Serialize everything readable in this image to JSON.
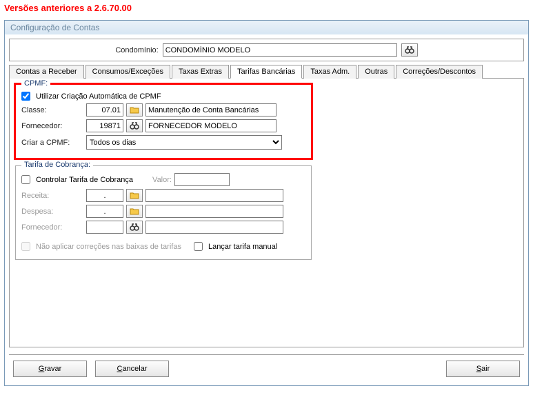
{
  "version_header": "Versões anteriores a 2.6.70.00",
  "window_title": "Configuração de Contas",
  "condominio": {
    "label": "Condomínio:",
    "value": "CONDOMÍNIO MODELO"
  },
  "tabs": {
    "receber": "Contas a Receber",
    "consumos": "Consumos/Exceções",
    "taxas": "Taxas Extras",
    "tarifas": "Tarifas Bancárias",
    "adm": "Taxas Adm.",
    "outras": "Outras",
    "correcoes": "Correções/Descontos"
  },
  "cpmf": {
    "legend": "CPMF:",
    "check_label": "Utilizar Criação Automática de CPMF",
    "classe_label": "Classe:",
    "classe_code": "07.01",
    "classe_desc": "Manutenção de Conta Bancárias",
    "fornecedor_label": "Fornecedor:",
    "fornecedor_code": "19871",
    "fornecedor_desc": "FORNECEDOR MODELO",
    "criar_label": "Criar a CPMF:",
    "criar_value": "Todos os dias"
  },
  "tarifa": {
    "legend": "Tarifa de Cobrança:",
    "controlar_label": "Controlar Tarifa de Cobrança",
    "valor_label": "Valor:",
    "receita_label": "Receita:",
    "receita_code": ".",
    "despesa_label": "Despesa:",
    "despesa_code": ".",
    "fornecedor_label": "Fornecedor:",
    "nao_aplicar_label": "Não aplicar correções nas baixas de tarifas",
    "lancar_label": "Lançar tarifa manual"
  },
  "buttons": {
    "gravar": "Gravar",
    "cancelar": "Cancelar",
    "sair": "Sair"
  }
}
